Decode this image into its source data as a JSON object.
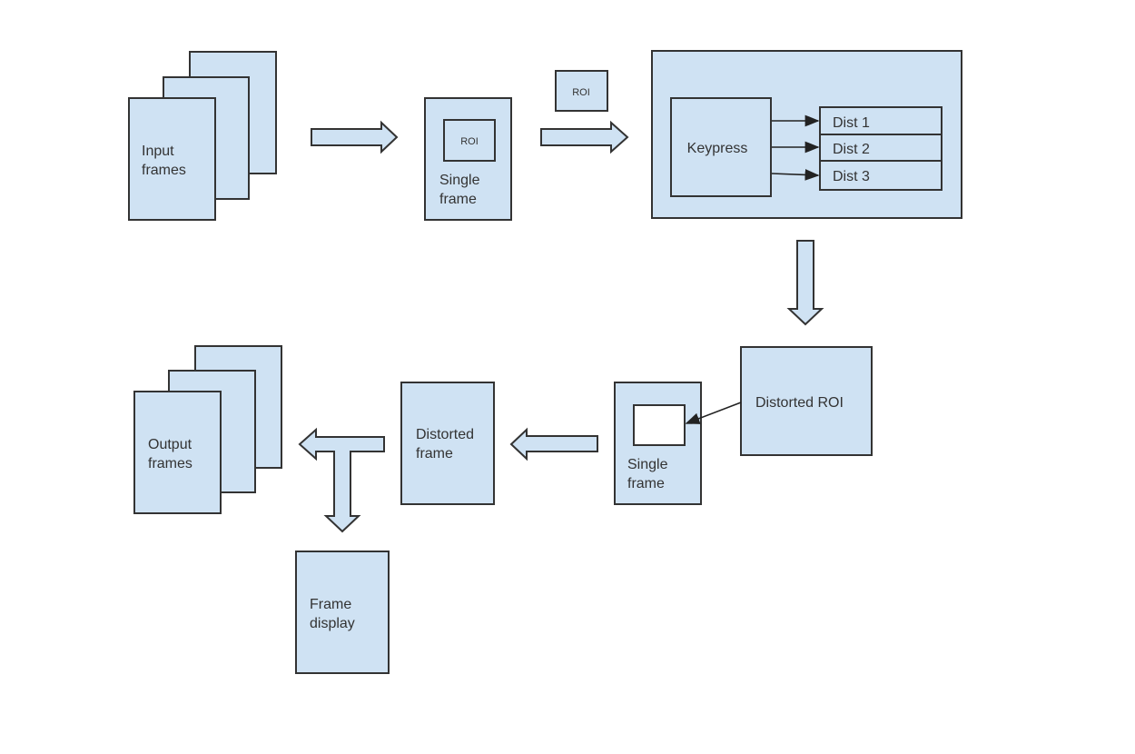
{
  "diagram": {
    "colors": {
      "fill": "#cfe2f3",
      "stroke": "#333333",
      "white_fill": "#ffffff"
    },
    "nodes": {
      "input_frames": {
        "line1": "Input",
        "line2": "frames"
      },
      "single_frame_top": {
        "roi": "ROI",
        "line1": "Single",
        "line2": "frame"
      },
      "roi_floating": "ROI",
      "keypress": "Keypress",
      "dist": [
        "Dist 1",
        "Dist 2",
        "Dist 3"
      ],
      "distorted_roi": "Distorted ROI",
      "single_frame_bottom": {
        "line1": "Single",
        "line2": "frame"
      },
      "distorted_frame": {
        "line1": "Distorted",
        "line2": "frame"
      },
      "output_frames": {
        "line1": "Output",
        "line2": "frames"
      },
      "frame_display": {
        "line1": "Frame",
        "line2": "display"
      }
    }
  }
}
